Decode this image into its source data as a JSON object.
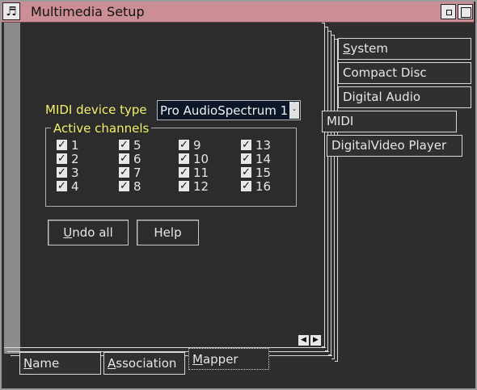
{
  "window": {
    "title": "Multimedia Setup"
  },
  "right_tabs": [
    {
      "label": "System",
      "mnemonic": "S"
    },
    {
      "label": "Compact Disc"
    },
    {
      "label": "Digital Audio"
    },
    {
      "label": "MIDI",
      "selected": true
    },
    {
      "label": "DigitalVideo Player"
    }
  ],
  "midi": {
    "device_type_label": "MIDI device type",
    "device_type_value": "Pro AudioSpectrum 1",
    "active_channels_label": "Active channels",
    "channels": [
      {
        "num": "1",
        "checked": true
      },
      {
        "num": "2",
        "checked": true
      },
      {
        "num": "3",
        "checked": true
      },
      {
        "num": "4",
        "checked": true
      },
      {
        "num": "5",
        "checked": true
      },
      {
        "num": "6",
        "checked": true
      },
      {
        "num": "7",
        "checked": true
      },
      {
        "num": "8",
        "checked": true
      },
      {
        "num": "9",
        "checked": true
      },
      {
        "num": "10",
        "checked": true
      },
      {
        "num": "11",
        "checked": true
      },
      {
        "num": "12",
        "checked": true
      },
      {
        "num": "13",
        "checked": true
      },
      {
        "num": "14",
        "checked": true
      },
      {
        "num": "15",
        "checked": true
      },
      {
        "num": "16",
        "checked": true
      }
    ],
    "check_glyph": "✓"
  },
  "buttons": {
    "undo_rest": "ndo all",
    "undo_mnemonic": "U",
    "help": "Help"
  },
  "bottom_tabs": {
    "name_rest": "ame",
    "name_mnemonic": "N",
    "assoc_rest": "ssociation",
    "assoc_mnemonic": "A",
    "mapper_rest": "apper",
    "mapper_mnemonic": "M"
  },
  "right_tab_system_rest": "ystem",
  "icons": {
    "sysmenu": "multimedia-icon",
    "left_arrow": "◀",
    "right_arrow": "▶"
  },
  "colors": {
    "title_bar": "#cc8e95",
    "label_yellow": "#f3f06c",
    "background": "#2c2c2c"
  }
}
